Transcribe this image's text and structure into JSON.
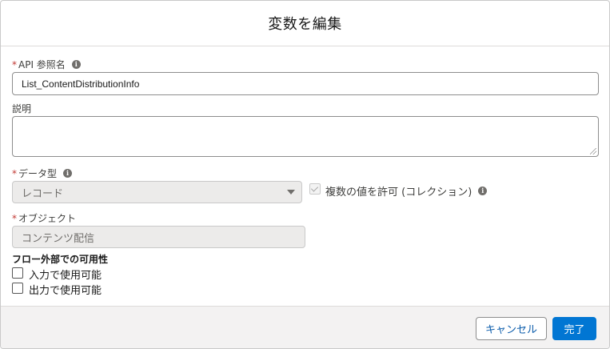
{
  "modal": {
    "title": "変数を編集"
  },
  "api_name": {
    "required_mark": "*",
    "label": "API 参照名",
    "info_icon": "i",
    "value": "List_ContentDistributionInfo"
  },
  "description": {
    "label": "説明",
    "value": ""
  },
  "data_type": {
    "required_mark": "*",
    "label": "データ型",
    "info_icon": "i",
    "selected": "レコード",
    "collection_label": "複数の値を許可 (コレクション)",
    "collection_checked": true,
    "collection_info_icon": "i"
  },
  "object": {
    "required_mark": "*",
    "label": "オブジェクト",
    "value": "コンテンツ配信"
  },
  "availability": {
    "title": "フロー外部での可用性",
    "input_label": "入力で使用可能",
    "input_checked": false,
    "output_label": "出力で使用可能",
    "output_checked": false
  },
  "footer": {
    "cancel_label": "キャンセル",
    "done_label": "完了"
  },
  "colors": {
    "brand": "#0176d3",
    "required": "#c23934",
    "footer_bg": "#f3f2f2"
  }
}
